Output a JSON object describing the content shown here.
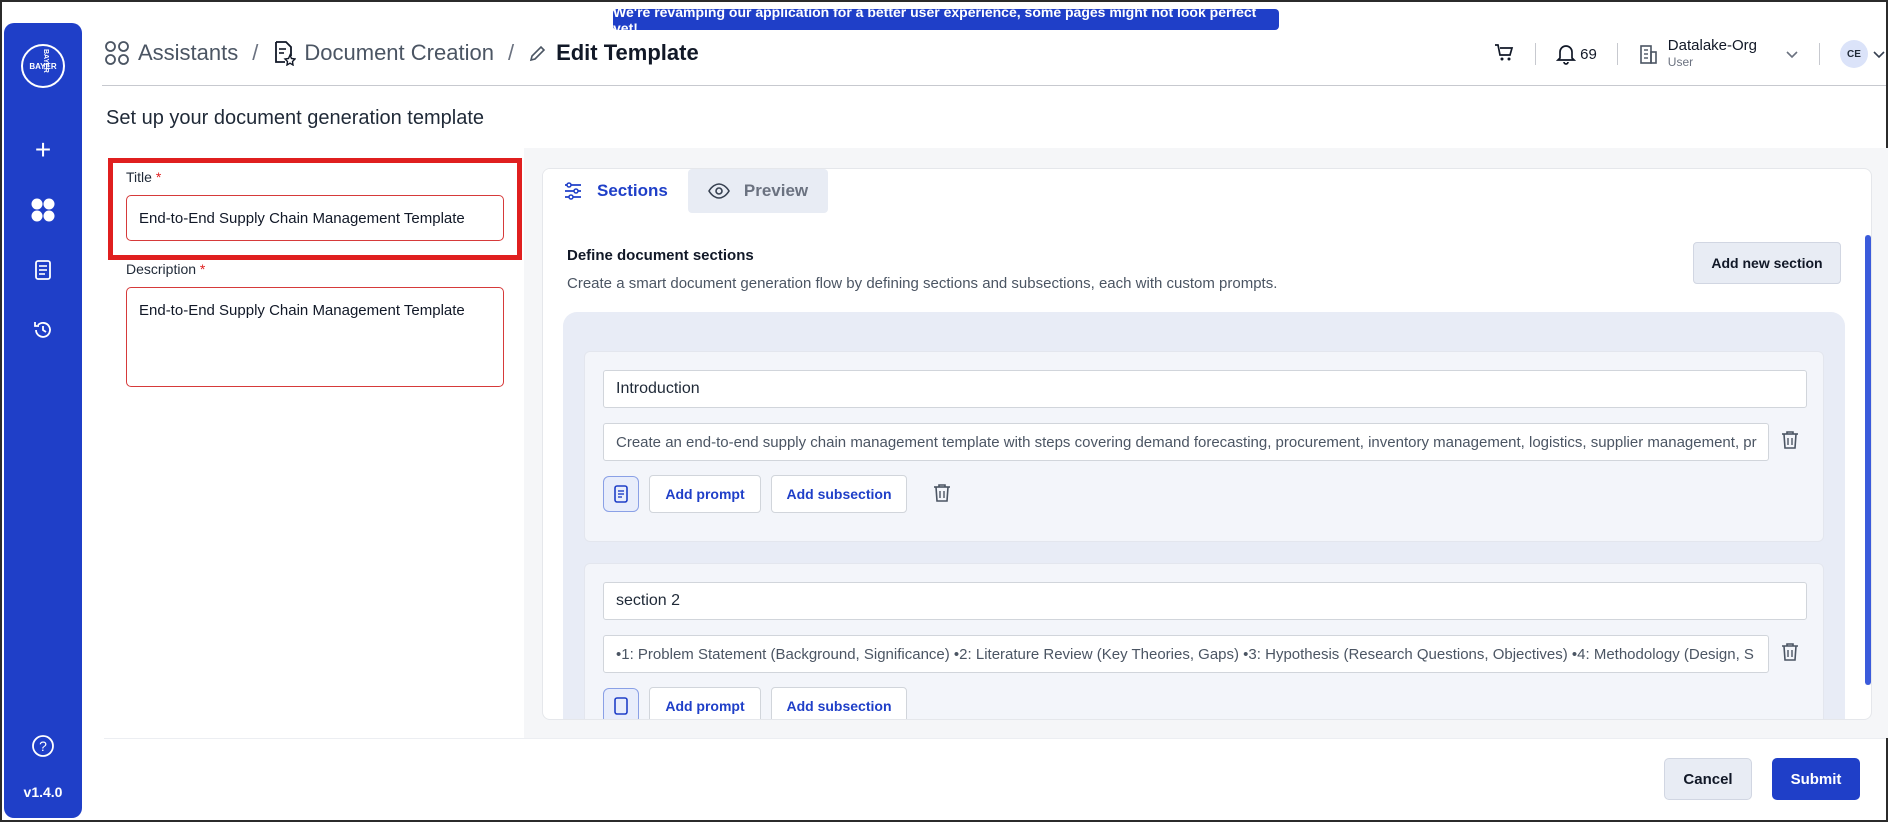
{
  "banner": {
    "text": "We're revamping our application for a better user experience, some pages might not look perfect yet!"
  },
  "sidebar": {
    "logo_text": "BAYER",
    "items": [
      {
        "name": "new",
        "icon": "plus-icon"
      },
      {
        "name": "assistants",
        "icon": "grid-icon"
      },
      {
        "name": "documents",
        "icon": "document-icon"
      },
      {
        "name": "history",
        "icon": "history-icon"
      }
    ],
    "help_icon": "help-icon",
    "version": "v1.4.0"
  },
  "breadcrumb": {
    "items": [
      {
        "label": "Assistants",
        "icon": "assistants-icon"
      },
      {
        "label": "Document Creation",
        "icon": "document-creation-icon"
      },
      {
        "label": "Edit Template",
        "icon": "pencil-icon"
      }
    ],
    "separator": "/"
  },
  "header": {
    "cart_icon": "cart-icon",
    "notifications": {
      "icon": "bell-icon",
      "count": "69"
    },
    "org": {
      "name": "Datalake-Org",
      "role": "User",
      "icon": "building-icon"
    },
    "avatar_initials": "CE"
  },
  "page_title": "Set up your document generation template",
  "form": {
    "title_label": "Title",
    "title_value": "End-to-End Supply Chain Management Template",
    "description_label": "Description",
    "description_value": "End-to-End Supply Chain Management Template",
    "required_marker": "*"
  },
  "tabs": [
    {
      "label": "Sections",
      "icon": "sliders-icon",
      "active": true
    },
    {
      "label": "Preview",
      "icon": "eye-icon",
      "active": false
    }
  ],
  "sections_panel": {
    "title": "Define document sections",
    "description": "Create a smart document generation flow by defining sections and subsections, each with custom prompts.",
    "add_section_label": "Add new section",
    "sections": [
      {
        "title": "Introduction",
        "prompt": "Create an end-to-end supply chain management template with steps covering demand forecasting, procurement, inventory management, logistics, supplier management, pr",
        "add_prompt_label": "Add prompt",
        "add_subsection_label": "Add subsection"
      },
      {
        "title": "section 2",
        "prompt": "•1: Problem Statement (Background, Significance) •2: Literature Review (Key Theories, Gaps) •3: Hypothesis (Research Questions, Objectives) •4: Methodology (Design, S",
        "add_prompt_label": "Add prompt",
        "add_subsection_label": "Add subsection"
      }
    ]
  },
  "footer": {
    "cancel_label": "Cancel",
    "submit_label": "Submit"
  },
  "colors": {
    "primary": "#1f3fc8",
    "error": "#e01f1f",
    "highlight": "#e01f1f"
  }
}
